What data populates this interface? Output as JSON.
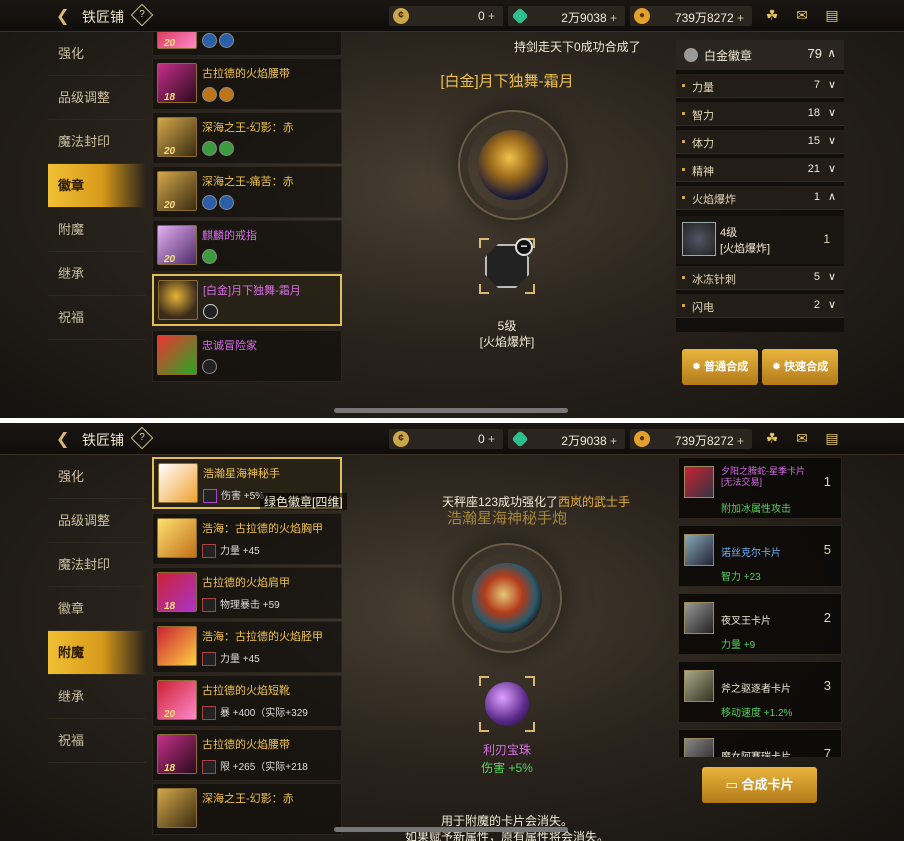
{
  "top": {
    "page_title": "铁匠铺",
    "help_label": "?",
    "currency": [
      {
        "icon": "c-coin-icon",
        "value": "0"
      },
      {
        "icon": "gem-icon",
        "value": "2万9038"
      },
      {
        "icon": "gold-coin-icon",
        "value": "739万8272"
      }
    ],
    "plus": "+",
    "icons": [
      "chest-icon",
      "mail-icon",
      "chat-icon"
    ]
  },
  "sidebar": [
    "强化",
    "品级调整",
    "魔法封印",
    "徽章",
    "附魔",
    "继承",
    "祝福"
  ],
  "panel1": {
    "active_tab": "徽章",
    "list": [
      {
        "level": "20",
        "name": "",
        "color": "gold"
      },
      {
        "level": "18",
        "name": "古拉德的火焰腰带",
        "color": "gold"
      },
      {
        "level": "20",
        "name": "深海之王-幻影：赤",
        "color": "gold"
      },
      {
        "level": "20",
        "name": "深海之王-痛苦：赤",
        "color": "gold"
      },
      {
        "level": "20",
        "name": "麒麟的戒指",
        "color": "purple"
      },
      {
        "level": "",
        "name": "[白金]月下独舞-霜月",
        "color": "purple"
      },
      {
        "level": "",
        "name": "忠诚冒险家",
        "color": "purple"
      }
    ],
    "notice": "持剑走天下0成功合成了",
    "title": "[白金]月下独舞-霜月",
    "emblem_level": "5级",
    "emblem_name": "[火焰爆炸]",
    "attr_header": {
      "name": "白金徽章",
      "value": "79"
    },
    "attrs": [
      {
        "name": "力量",
        "value": "7",
        "chev": "∨"
      },
      {
        "name": "智力",
        "value": "18",
        "chev": "∨"
      },
      {
        "name": "体力",
        "value": "15",
        "chev": "∨"
      },
      {
        "name": "精神",
        "value": "21",
        "chev": "∨"
      },
      {
        "name": "火焰爆炸",
        "value": "1",
        "chev": "∧"
      },
      {
        "name": "冰冻针刺",
        "value": "5",
        "chev": "∨"
      },
      {
        "name": "闪电",
        "value": "2",
        "chev": "∨"
      }
    ],
    "sub_item": {
      "level": "4级",
      "name": "[火焰爆炸]",
      "count": "1"
    },
    "buttons": [
      "普通合成",
      "快速合成"
    ]
  },
  "panel2": {
    "active_tab": "附魔",
    "list": [
      {
        "level": "",
        "name": "浩瀚星海神秘手",
        "stat": "伤害 +5%",
        "color": "gold"
      },
      {
        "level": "",
        "name": "浩海：古拉德的火焰胸甲",
        "stat": "力量 +45",
        "color": "gold"
      },
      {
        "level": "18",
        "name": "古拉德的火焰肩甲",
        "stat": "物理暴击 +59",
        "color": "gold"
      },
      {
        "level": "",
        "name": "浩海：古拉德的火焰胫甲",
        "stat": "力量 +45",
        "color": "gold"
      },
      {
        "level": "20",
        "name": "古拉德的火焰短靴",
        "stat": "暴 +400（实际+329",
        "color": "gold"
      },
      {
        "level": "18",
        "name": "古拉德的火焰腰带",
        "stat": "限 +265（实际+218",
        "color": "gold"
      },
      {
        "level": "",
        "name": "深海之王-幻影：赤",
        "stat": "",
        "color": "gold"
      }
    ],
    "notice_left": "绿色徽章[四维]",
    "notice_right": "天秤座123成功强化了",
    "notice_right_highlight": "西岚的武士手",
    "title": "浩瀚星海神秘手炮",
    "card_name": "利刃宝珠",
    "card_stat": "伤害 +5%",
    "warning_line1": "用于附魔的卡片会消失。",
    "warning_line2": "如果赋予新属性，原有属性将会消失。",
    "cards": [
      {
        "name": "夕阳之腾蛇-星季卡片[无法交易]",
        "stat": "附加冰属性攻击",
        "count": "1"
      },
      {
        "name": "诺丝克尔卡片",
        "stat": "智力 +23",
        "count": "5"
      },
      {
        "name": "夜叉王卡片",
        "stat": "力量 +9",
        "count": "2"
      },
      {
        "name": "斧之驱逐者卡片",
        "stat": "移动速度 +1.2%",
        "count": "3"
      },
      {
        "name": "魔女阿赛瑞卡片",
        "stat": "",
        "count": "7"
      }
    ],
    "button": "合成卡片"
  }
}
